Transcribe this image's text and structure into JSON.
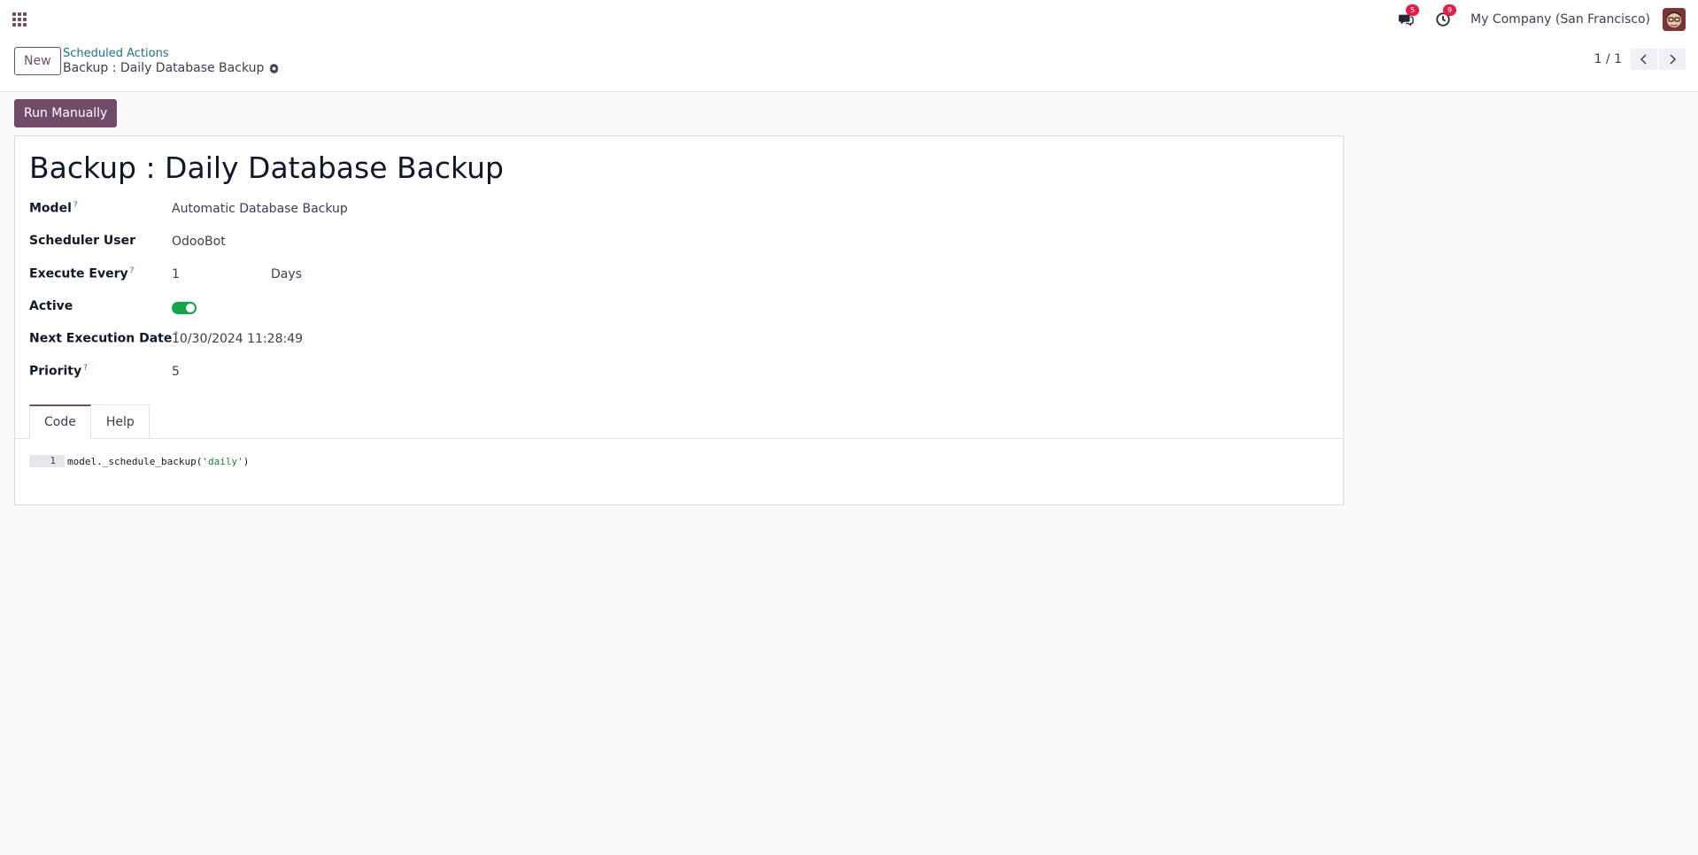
{
  "navbar": {
    "apps_icon": "apps-grid-icon",
    "messages_badge": "5",
    "activities_badge": "9",
    "company": "My Company (San Francisco)"
  },
  "control": {
    "new_label": "New",
    "breadcrumb_parent": "Scheduled Actions",
    "breadcrumb_current": "Backup : Daily Database Backup",
    "pager_value": "1 / 1"
  },
  "actions": {
    "run_manually": "Run Manually"
  },
  "form": {
    "title": "Backup : Daily Database Backup",
    "fields": {
      "model_label": "Model",
      "model_value": "Automatic Database Backup",
      "user_label": "Scheduler User",
      "user_value": "OdooBot",
      "execute_label": "Execute Every",
      "execute_value": "1",
      "execute_unit": "Days",
      "active_label": "Active",
      "active_value": true,
      "next_label": "Next Execution Date",
      "next_value": "10/30/2024 11:28:49",
      "priority_label": "Priority",
      "priority_value": "5"
    },
    "help_mark": "?",
    "tabs": [
      "Code",
      "Help"
    ],
    "code": {
      "line_number": "1",
      "prefix": "model._schedule_backup(",
      "string": "'daily'",
      "suffix": ")"
    }
  },
  "colors": {
    "brand": "#714b67",
    "toggle_on": "#16a34a",
    "badge": "#e11d48"
  }
}
